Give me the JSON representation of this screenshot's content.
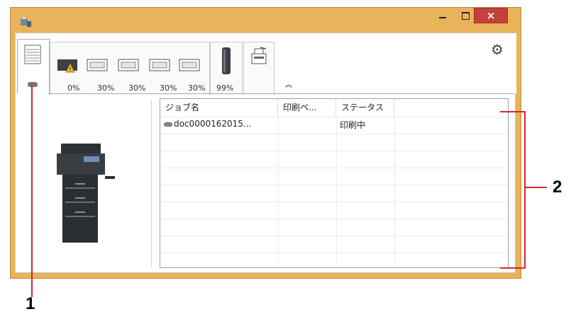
{
  "window": {
    "title": "",
    "buttons": {
      "minimize": "minimize",
      "maximize": "maximize",
      "close": "×"
    }
  },
  "toolbar": {
    "trays": [
      {
        "label": "0%",
        "warning": true
      },
      {
        "label": "30%"
      },
      {
        "label": "30%"
      },
      {
        "label": "30%"
      },
      {
        "label": "30%"
      }
    ],
    "toner": {
      "label": "99%"
    },
    "collapse_glyph": "︽",
    "settings_glyph": "⚙"
  },
  "job_table": {
    "columns": [
      "ジョブ名",
      "印刷ペ...",
      "ステータス"
    ],
    "rows": [
      {
        "name": "doc0000162015...",
        "pages": "",
        "status": "印刷中"
      }
    ]
  },
  "callouts": {
    "one": "1",
    "two": "2"
  },
  "colors": {
    "frame": "#e8b35a",
    "close": "#c4413b",
    "callout": "#d7262d"
  }
}
